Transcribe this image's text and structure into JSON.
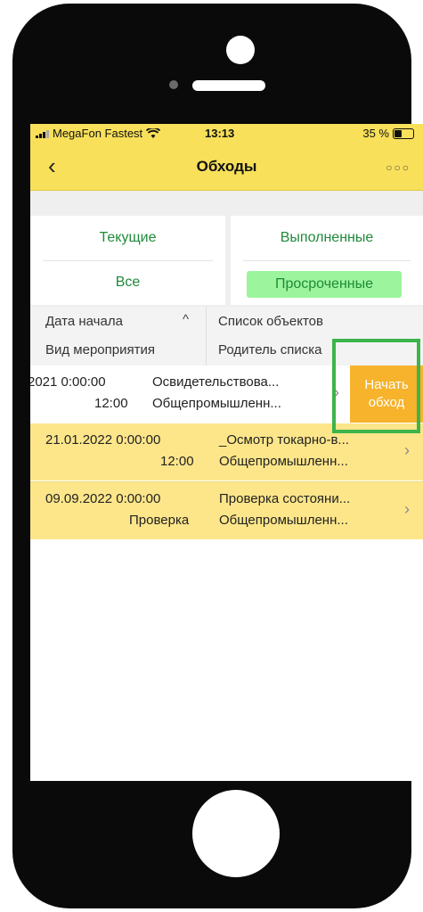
{
  "status_bar": {
    "carrier": "MegaFon Fastest",
    "time": "13:13",
    "battery": "35 %"
  },
  "nav": {
    "back_icon": "chevron-left-icon",
    "title": "Обходы",
    "more_icon": "ellipsis-icon"
  },
  "filters": {
    "current": "Текущие",
    "completed": "Выполненные",
    "all": "Все",
    "overdue": "Просроченные",
    "active": "overdue",
    "active_color": "#9cf59c",
    "text_color": "#1f8a3a"
  },
  "columns": {
    "start_date": "Дата начала",
    "event_type": "Вид мероприятия",
    "objects_list": "Список объектов",
    "list_parent": "Родитель списка",
    "sort_icon": "chevron-up-icon"
  },
  "rows": [
    {
      "date": "2021 0:00:00",
      "type": "12:00",
      "objects": "Освидетельствова...",
      "parent": "Общепромышленн..."
    },
    {
      "date": "21.01.2022 0:00:00",
      "type": "12:00",
      "objects": "_Осмотр токарно-в...",
      "parent": "Общепромышленн..."
    },
    {
      "date": "09.09.2022 0:00:00",
      "type": "Проверка",
      "objects": "Проверка состояни...",
      "parent": "Общепромышленн..."
    }
  ],
  "swipe_action": {
    "line1": "Начать",
    "line2": "обход",
    "color": "#f7b32b"
  },
  "colors": {
    "header_yellow": "#f8e05a",
    "row_selected": "#fde68a",
    "highlight": "#3cb44b"
  }
}
